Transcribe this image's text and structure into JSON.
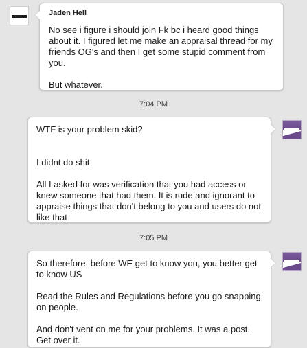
{
  "messages": [
    {
      "sender": "Jaden Hell",
      "paragraphs": [
        "No see i figure i should join Fk bc i heard good things about it. I figured let me make an appraisal thread for my friends OG's and then I get some stupid comment from you.",
        "But whatever."
      ]
    },
    {
      "paragraphs": [
        "WTF is your problem skid?",
        "I didnt do shit",
        "All I asked for was verification that you had access or knew someone that had them. It is rude and ignorant to appraise things that don't belong to you and users do not like that"
      ]
    },
    {
      "paragraphs": [
        "So therefore, before WE get to know you, you better get to know US",
        "Read the Rules and Regulations before you go snapping on people.",
        "And don't vent on me for your problems. It was a post. Get over it."
      ]
    }
  ],
  "timestamps": [
    "7:04 PM",
    "7:05 PM"
  ],
  "colors": {
    "background": "#e5e5e5",
    "bubble": "#ffffff",
    "avatar_purple": "#6b4a8c"
  }
}
